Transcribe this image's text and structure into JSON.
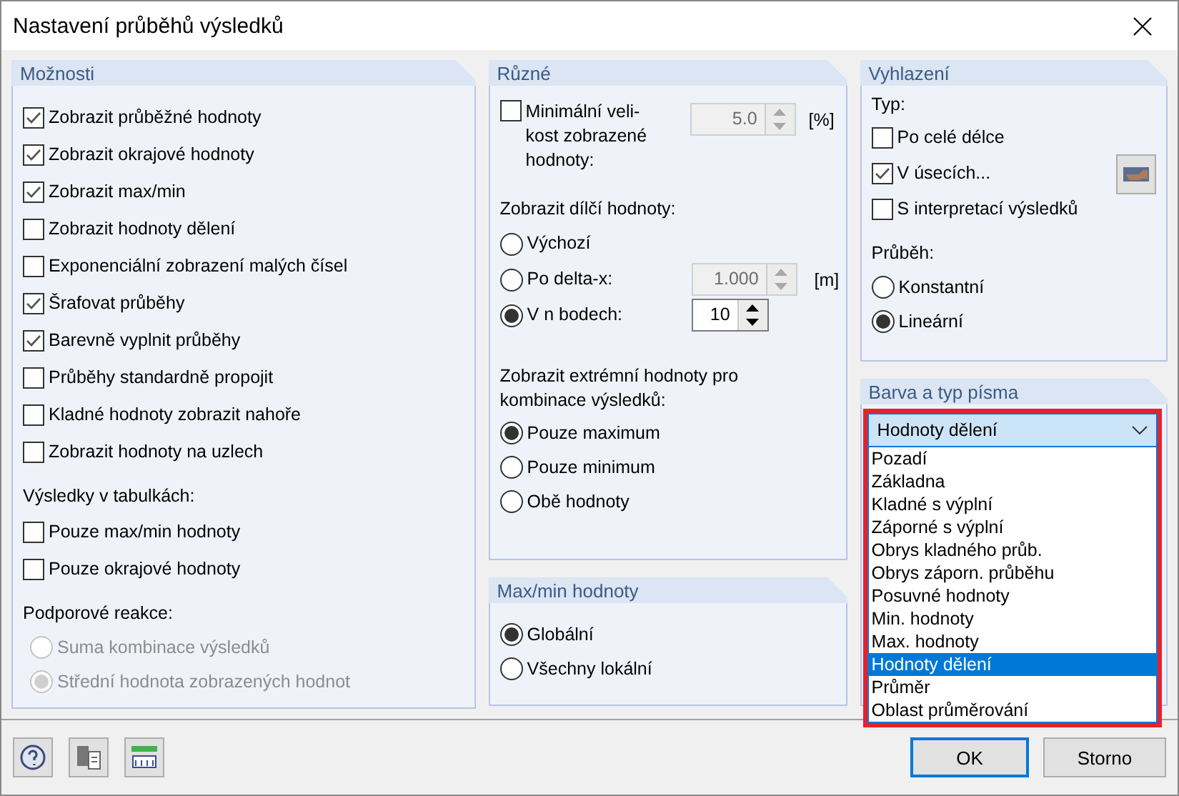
{
  "window": {
    "title": "Nastavení průběhů výsledků"
  },
  "options": {
    "title": "Možnosti",
    "checkboxes": [
      {
        "label": "Zobrazit průběžné hodnoty",
        "checked": true
      },
      {
        "label": "Zobrazit okrajové hodnoty",
        "checked": true
      },
      {
        "label": "Zobrazit max/min",
        "checked": true
      },
      {
        "label": "Zobrazit  hodnoty dělení",
        "checked": false
      },
      {
        "label": "Exponenciální zobrazení malých čísel",
        "checked": false
      },
      {
        "label": "Šrafovat průběhy",
        "checked": true
      },
      {
        "label": "Barevně vyplnit průběhy",
        "checked": true
      },
      {
        "label": "Průběhy standardně propojit",
        "checked": false
      },
      {
        "label": "Kladné hodnoty zobrazit nahoře",
        "checked": false
      },
      {
        "label": "Zobrazit hodnoty na uzlech",
        "checked": false
      }
    ],
    "table_results": {
      "label": "Výsledky v tabulkách:",
      "checkboxes": [
        {
          "label": "Pouze max/min hodnoty",
          "checked": false
        },
        {
          "label": "Pouze okrajové hodnoty",
          "checked": false
        }
      ]
    },
    "support_reactions": {
      "label": "Podporové reakce:",
      "radios": [
        {
          "label": "Suma kombinace výsledků",
          "selected": false,
          "disabled": true
        },
        {
          "label": "Střední hodnota zobrazených hodnot",
          "selected": true,
          "disabled": true
        }
      ]
    }
  },
  "various": {
    "title": "Různé",
    "min_size": {
      "label": "Minimální veli-\nkost zobrazené\nhodnoty:",
      "checked": false,
      "spinner": {
        "value": "5.0",
        "unit": "[%]",
        "disabled": true
      }
    },
    "partial": {
      "label": "Zobrazit dílčí hodnoty:",
      "radios": [
        {
          "label": "Výchozí",
          "selected": false
        },
        {
          "label": "Po delta-x:",
          "selected": false,
          "spinner": {
            "value": "1.000",
            "unit": "[m]",
            "disabled": true
          }
        },
        {
          "label": "V n bodech:",
          "selected": true,
          "spinner": {
            "value": "10",
            "disabled": false
          }
        }
      ]
    },
    "extremes": {
      "label": "Zobrazit extrémní hodnoty pro\nkombinace výsledků:",
      "radios": [
        {
          "label": "Pouze maximum",
          "selected": true
        },
        {
          "label": "Pouze minimum",
          "selected": false
        },
        {
          "label": "Obě hodnoty",
          "selected": false
        }
      ]
    }
  },
  "maxmin": {
    "title": "Max/min hodnoty",
    "radios": [
      {
        "label": "Globální",
        "selected": true
      },
      {
        "label": "Všechny lokální",
        "selected": false
      }
    ]
  },
  "smoothing": {
    "title": "Vyhlazení",
    "type_label": "Typ:",
    "checkboxes": [
      {
        "label": "Po celé délce",
        "checked": false,
        "kind": "plain"
      },
      {
        "label": "V úsecích...",
        "checked": true,
        "kind": "with_button"
      },
      {
        "label": "S interpretací výsledků",
        "checked": false,
        "kind": "plain"
      }
    ],
    "course": {
      "label": "Průběh:",
      "radios": [
        {
          "label": "Konstantní",
          "selected": false
        },
        {
          "label": "Lineární",
          "selected": true
        }
      ]
    }
  },
  "font": {
    "title": "Barva a typ písma",
    "combo": {
      "value": "Hodnoty dělení",
      "expanded": true,
      "highlighted": true
    },
    "options": [
      {
        "label": "Pozadí",
        "selected": false
      },
      {
        "label": "Základna",
        "selected": false
      },
      {
        "label": "Kladné s výplní",
        "selected": false
      },
      {
        "label": "Záporné s výplní",
        "selected": false
      },
      {
        "label": "Obrys kladného průb.",
        "selected": false
      },
      {
        "label": "Obrys záporn. průběhu",
        "selected": false
      },
      {
        "label": "Posuvné hodnoty",
        "selected": false
      },
      {
        "label": "Min. hodnoty",
        "selected": false
      },
      {
        "label": "Max. hodnoty",
        "selected": false
      },
      {
        "label": "Hodnoty dělení",
        "selected": true
      },
      {
        "label": "Průměr",
        "selected": false
      },
      {
        "label": "Oblast průměrování",
        "selected": false
      }
    ]
  },
  "buttons": [
    {
      "label": "OK",
      "default": true
    },
    {
      "label": "Storno",
      "default": false
    }
  ]
}
